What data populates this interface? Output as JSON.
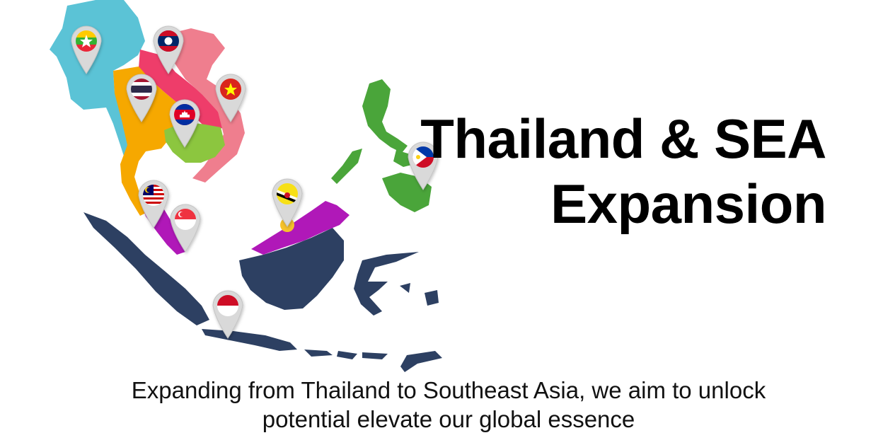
{
  "title": {
    "line1": "Thailand & SEA",
    "line2": "Expansion"
  },
  "subtitle": {
    "line1": "Expanding from Thailand to Southeast Asia, we aim to unlock",
    "line2": "potential elevate our global essence"
  },
  "map": {
    "regions": [
      {
        "name": "myanmar",
        "color": "#5bc3d6"
      },
      {
        "name": "thailand",
        "color": "#f6a800"
      },
      {
        "name": "laos",
        "color": "#ee3d6a"
      },
      {
        "name": "vietnam",
        "color": "#ef7e8e"
      },
      {
        "name": "cambodia",
        "color": "#8cc63f"
      },
      {
        "name": "malaysia",
        "color": "#b018b8"
      },
      {
        "name": "indonesia",
        "color": "#2d4062"
      },
      {
        "name": "philippines",
        "color": "#4aa53a"
      },
      {
        "name": "brunei",
        "color": "#f6c22a"
      }
    ],
    "pins": [
      {
        "country": "myanmar",
        "icon": "myanmar-flag-pin-icon"
      },
      {
        "country": "laos",
        "icon": "laos-flag-pin-icon"
      },
      {
        "country": "thailand",
        "icon": "thailand-flag-pin-icon"
      },
      {
        "country": "vietnam",
        "icon": "vietnam-flag-pin-icon"
      },
      {
        "country": "cambodia",
        "icon": "cambodia-flag-pin-icon"
      },
      {
        "country": "malaysia",
        "icon": "malaysia-flag-pin-icon"
      },
      {
        "country": "singapore",
        "icon": "singapore-flag-pin-icon"
      },
      {
        "country": "brunei",
        "icon": "brunei-flag-pin-icon"
      },
      {
        "country": "indonesia",
        "icon": "indonesia-flag-pin-icon"
      },
      {
        "country": "philippines",
        "icon": "philippines-flag-pin-icon"
      }
    ]
  }
}
